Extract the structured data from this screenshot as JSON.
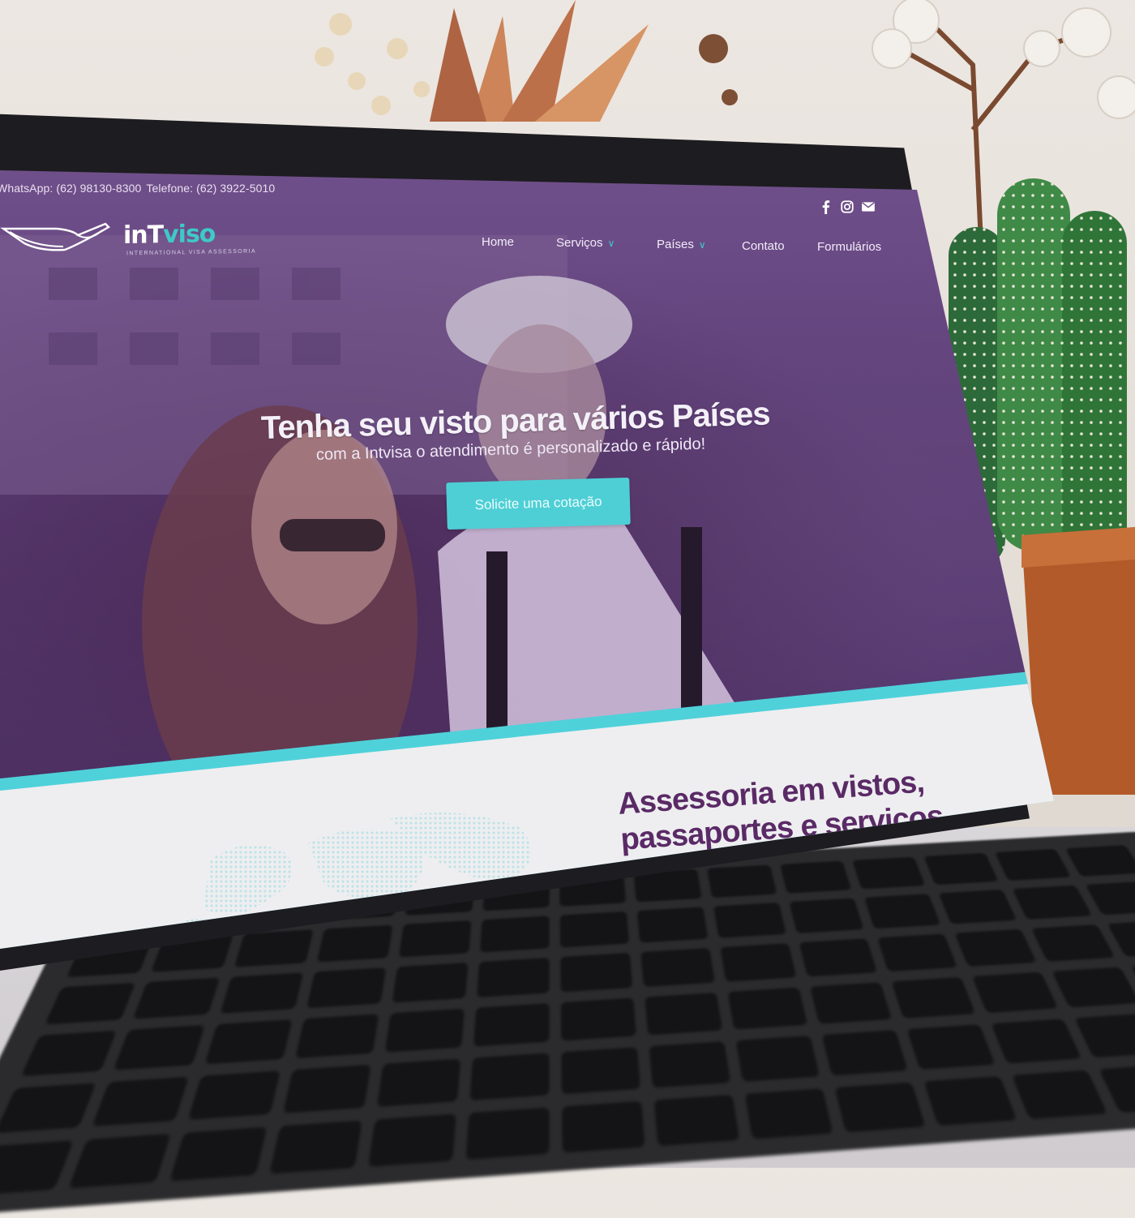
{
  "topbar": {
    "whatsapp": "WhatsApp: (62) 98130-8300",
    "telefone": "Telefone: (62) 3922-5010"
  },
  "social": [
    "facebook-icon",
    "instagram-icon",
    "envelope-icon"
  ],
  "logo": {
    "word_main": "inT",
    "word_accent": "viso",
    "tagline": "INTERNATIONAL VISA ASSESSORIA"
  },
  "nav": {
    "home": "Home",
    "servicos": "Serviços",
    "paises": "Países",
    "contato": "Contato",
    "formularios": "Formulários"
  },
  "hero": {
    "title": "Tenha seu visto para vários Países",
    "subtitle": "com a Intvisa o atendimento é personalizado e rápido!",
    "cta": "Solicite uma cotação"
  },
  "section": {
    "title_line1": "Assessoria em vistos,",
    "title_line2": "passaportes e serviços"
  },
  "colors": {
    "hero_overlay": "#6f4f8a",
    "accent_cyan": "#4ecfd5",
    "section_title": "#5a2a66"
  }
}
